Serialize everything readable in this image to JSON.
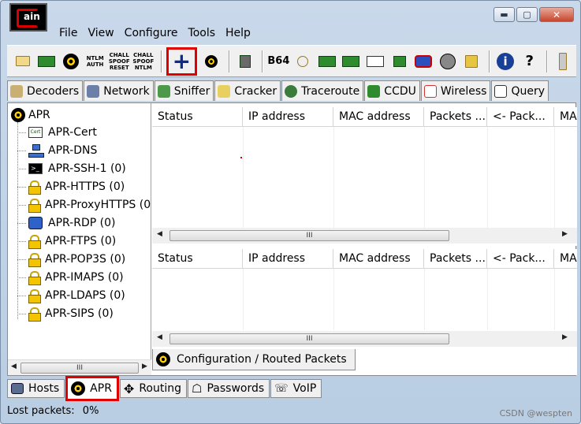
{
  "app": {
    "logo_text": "ain"
  },
  "window_controls": {
    "minimize": "▬",
    "maximize": "▢",
    "close": "✕"
  },
  "menu": [
    "File",
    "View",
    "Configure",
    "Tools",
    "Help"
  ],
  "toolbar": {
    "ntlm_auth": "NTLM AUTH",
    "chall_spoof_reset": "CHALL SPOOF RESET",
    "chall_spoof_ntlm": "CHALL SPOOF NTLM",
    "add_label": "+",
    "b64": "B64",
    "info": "i",
    "help": "?"
  },
  "tabs": [
    "Decoders",
    "Network",
    "Sniffer",
    "Cracker",
    "Traceroute",
    "CCDU",
    "Wireless",
    "Query"
  ],
  "tree": {
    "root": "APR",
    "items": [
      {
        "label": "APR-Cert",
        "icon": "cert-icon"
      },
      {
        "label": "APR-DNS",
        "icon": "network-icon"
      },
      {
        "label": "APR-SSH-1 (0)",
        "icon": "terminal-icon"
      },
      {
        "label": "APR-HTTPS (0)",
        "icon": "lock-icon"
      },
      {
        "label": "APR-ProxyHTTPS (0",
        "icon": "lock-icon"
      },
      {
        "label": "APR-RDP (0)",
        "icon": "rdp-icon"
      },
      {
        "label": "APR-FTPS (0)",
        "icon": "lock-icon"
      },
      {
        "label": "APR-POP3S (0)",
        "icon": "lock-icon"
      },
      {
        "label": "APR-IMAPS (0)",
        "icon": "lock-icon"
      },
      {
        "label": "APR-LDAPS (0)",
        "icon": "lock-icon"
      },
      {
        "label": "APR-SIPS (0)",
        "icon": "lock-icon"
      }
    ]
  },
  "columns": [
    "Status",
    "IP address",
    "MAC address",
    "Packets ...",
    "<- Pack...",
    "MA"
  ],
  "scroll_thumb": "III",
  "routed_tab": "Configuration / Routed Packets",
  "bottom_tabs": [
    "Hosts",
    "APR",
    "Routing",
    "Passwords",
    "VoIP"
  ],
  "status": {
    "label": "Lost packets:",
    "value": "0%"
  },
  "watermark": "CSDN @wespten",
  "colors": {
    "highlight": "#e00000",
    "apr_yellow": "#ffd200"
  }
}
